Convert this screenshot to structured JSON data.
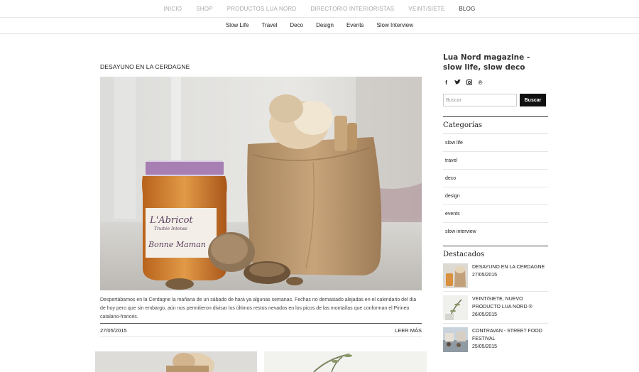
{
  "top_nav": [
    "INICIO",
    "SHOP",
    "PRODUCTOS LUA NORD",
    "DIRECTORIO INTERIORISTAS",
    "VEINT/SIETE",
    "BLOG"
  ],
  "top_nav_active": "BLOG",
  "sub_nav": [
    "Slow Life",
    "Travel",
    "Deco",
    "Design",
    "Events",
    "Slow Interview"
  ],
  "post": {
    "title": "DESAYUNO EN LA CERDAGNE",
    "excerpt": "Despertábamos en la Cerdagne la mañana de un sábado de hará ya algunas semanas. Fechas no demasiado alejadas en el calendario del día de hoy pero que sin embargo, aún nos permitieron divisar los últimos restos nevados en los picos de las montañas que conforman el Pirineo catalano-francés.",
    "date": "27/05/2015",
    "read_more": "LEER MÁS"
  },
  "sidebar": {
    "site_title": "Lua Nord magazine - slow life, slow deco",
    "social_icons": [
      "facebook-icon",
      "twitter-icon",
      "instagram-icon",
      "pinterest-icon"
    ],
    "search": {
      "placeholder": "Buscar",
      "button": "Buscar"
    },
    "categories_title": "Categorías",
    "categories": [
      "slow life",
      "travel",
      "deco",
      "design",
      "events",
      "slow interview"
    ],
    "featured_title": "Destacados",
    "featured": [
      {
        "title": "DESAYUNO EN LA CERDAGNE",
        "date": "27/05/2015"
      },
      {
        "title": "VEINT/SIETE, NUEVO PRODUCTO LUA NORD ®",
        "date": "26/05/2015"
      },
      {
        "title": "CONTRAVAN - STREET FOOD FESTIVAL",
        "date": "25/05/2015"
      }
    ]
  },
  "colors": {
    "nav_inactive": "#aaaaaa",
    "text": "#222222",
    "button_bg": "#111111"
  }
}
